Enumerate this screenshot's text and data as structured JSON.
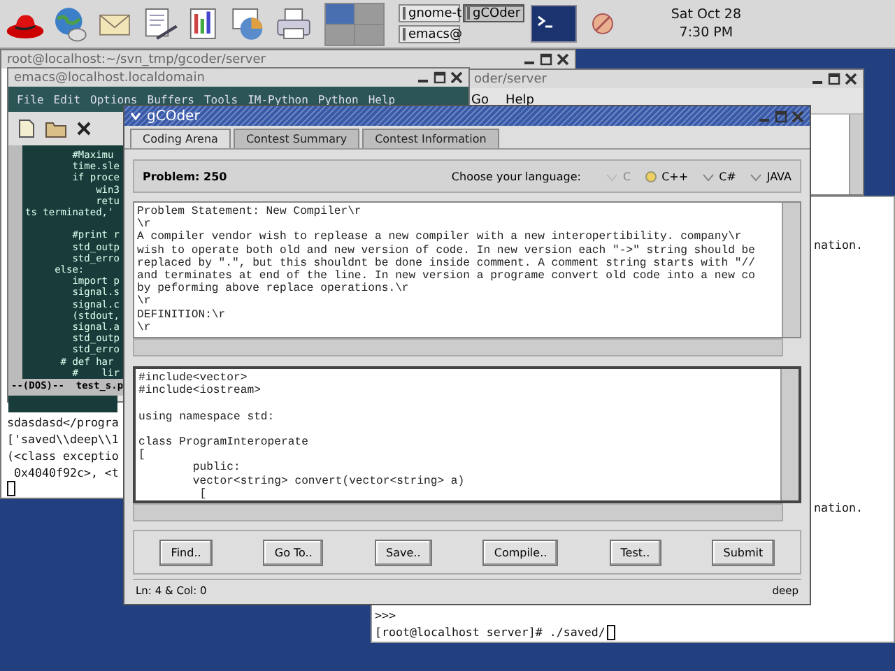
{
  "panel": {
    "taskbar": [
      {
        "label": "gnome-t",
        "selected": false
      },
      {
        "label": "gCOder",
        "selected": true
      },
      {
        "label": "emacs@",
        "selected": false
      }
    ],
    "clock": {
      "date": "Sat Oct 28",
      "time": "7:30 PM"
    }
  },
  "back_terminal": {
    "title": "root@localhost:~/svn_tmp/gcoder/server",
    "lines": [
      "sdasdasd</progra",
      "['saved\\\\deep\\\\1",
      "(<class exceptio",
      " 0x4040f92c>, <t"
    ]
  },
  "file_window": {
    "title": "oder/server",
    "menu": [
      "Go",
      "Help"
    ]
  },
  "right_terminal": {
    "lines": [
      {
        "text": "nation."
      },
      {
        "text": "nation."
      }
    ],
    "prompt_lines": [
      ">>>",
      "[root@localhost server]# ./saved/"
    ]
  },
  "emacs": {
    "title": "emacs@localhost.localdomain",
    "menu": [
      "File",
      "Edit",
      "Options",
      "Buffers",
      "Tools",
      "IM-Python",
      "Python",
      "Help"
    ],
    "code": "        #Maximu\n        time.sle\n        if proce\n            win3\n            retu\nts terminated,'\n\n        #print r\n        std_outp\n        std_erro\n     else:\n        import p\n        signal.s\n        signal.c\n        (stdout,\n        signal.a\n        std_outp\n        std_erro\n      # def har\n        #    lir",
    "mode_line": "--(DOS)--  test_s.p"
  },
  "gcoder": {
    "title": "gCOder",
    "tabs": [
      {
        "label": "Coding Arena",
        "selected": true
      },
      {
        "label": "Contest Summary",
        "selected": false
      },
      {
        "label": "Contest Information",
        "selected": false
      }
    ],
    "problem_label": "Problem: 250",
    "language_label": "Choose your language:",
    "languages": [
      {
        "label": "C",
        "selected": false,
        "disabled": true
      },
      {
        "label": "C++",
        "selected": true,
        "disabled": false
      },
      {
        "label": "C#",
        "selected": false,
        "disabled": false
      },
      {
        "label": "JAVA",
        "selected": false,
        "disabled": false
      }
    ],
    "problem_text": "Problem Statement: New Compiler\\r\n\\r\nA compiler vendor wish to replease a new compiler with a new interopertibility. company\\r\nwish to operate both old and new version of code. In new version each \"->\" string should be\nreplaced by \".\", but this shouldnt be done inside comment. A comment string starts with \"//\nand terminates at end of the line. In new version a programe convert old code into a new co\nby peforming above replace operations.\\r\n\\r\nDEFINITION:\\r\n\\r",
    "code": "#include<vector>\n#include<iostream>\n\nusing namespace std:\n\nclass ProgramInteroperate\n[\n        public:\n        vector<string> convert(vector<string> a)\n         [",
    "buttons": [
      "Find..",
      "Go To..",
      "Save..",
      "Compile..",
      "Test..",
      "Submit"
    ],
    "status_left": "Ln: 4 & Col: 0",
    "status_right": "deep"
  }
}
